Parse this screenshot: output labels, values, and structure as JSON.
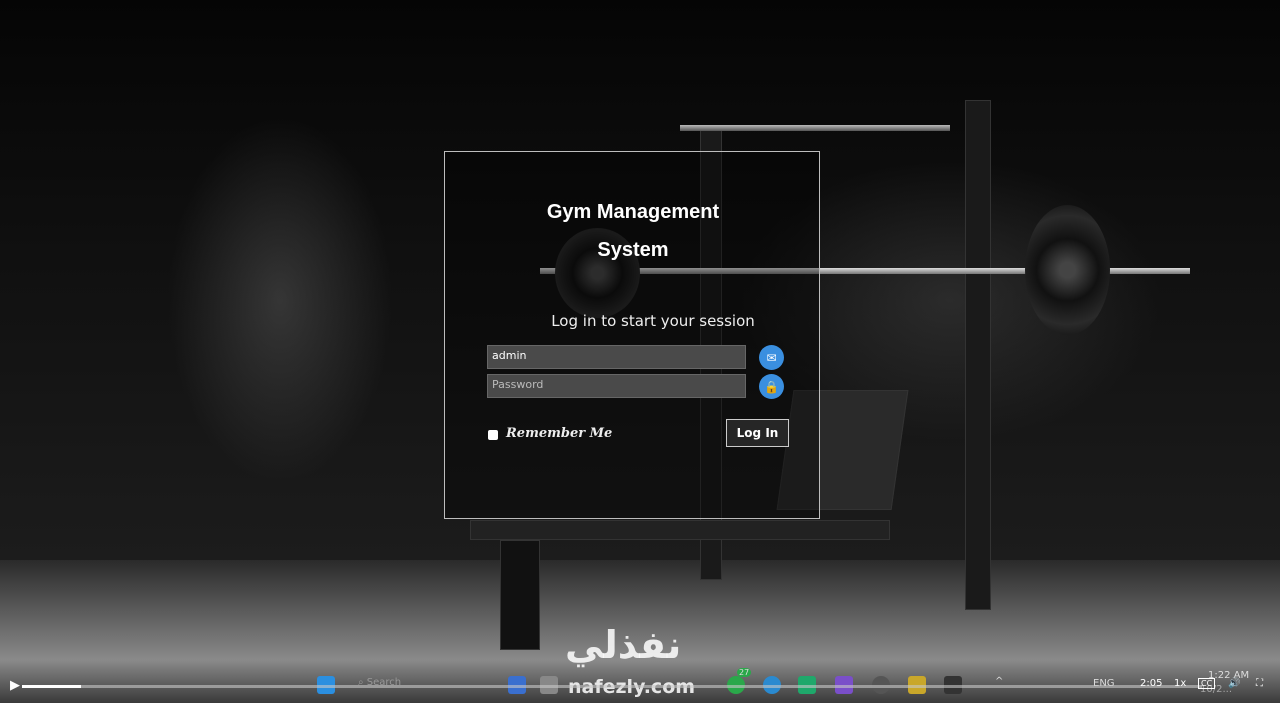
{
  "login": {
    "title_line1": "Gym Management",
    "title_line2": "System",
    "subtitle": "Log in to start your session",
    "username_value": "admin",
    "password_placeholder": "Password",
    "remember_label": "Remember Me",
    "login_button": "Log In"
  },
  "taskbar": {
    "search_placeholder": "Search",
    "whatsapp_badge": "27",
    "language": "ENG",
    "time": "1:22 AM",
    "date": "10/2..."
  },
  "player": {
    "elapsed": "2:05",
    "speed": "1x",
    "cc": "CC",
    "progress_percent": 5
  },
  "watermark": {
    "arabic": "نفذلي",
    "latin": "nafezly.com"
  },
  "colors": {
    "accent": "#3a8fe0",
    "border": "#bdbdbd"
  }
}
